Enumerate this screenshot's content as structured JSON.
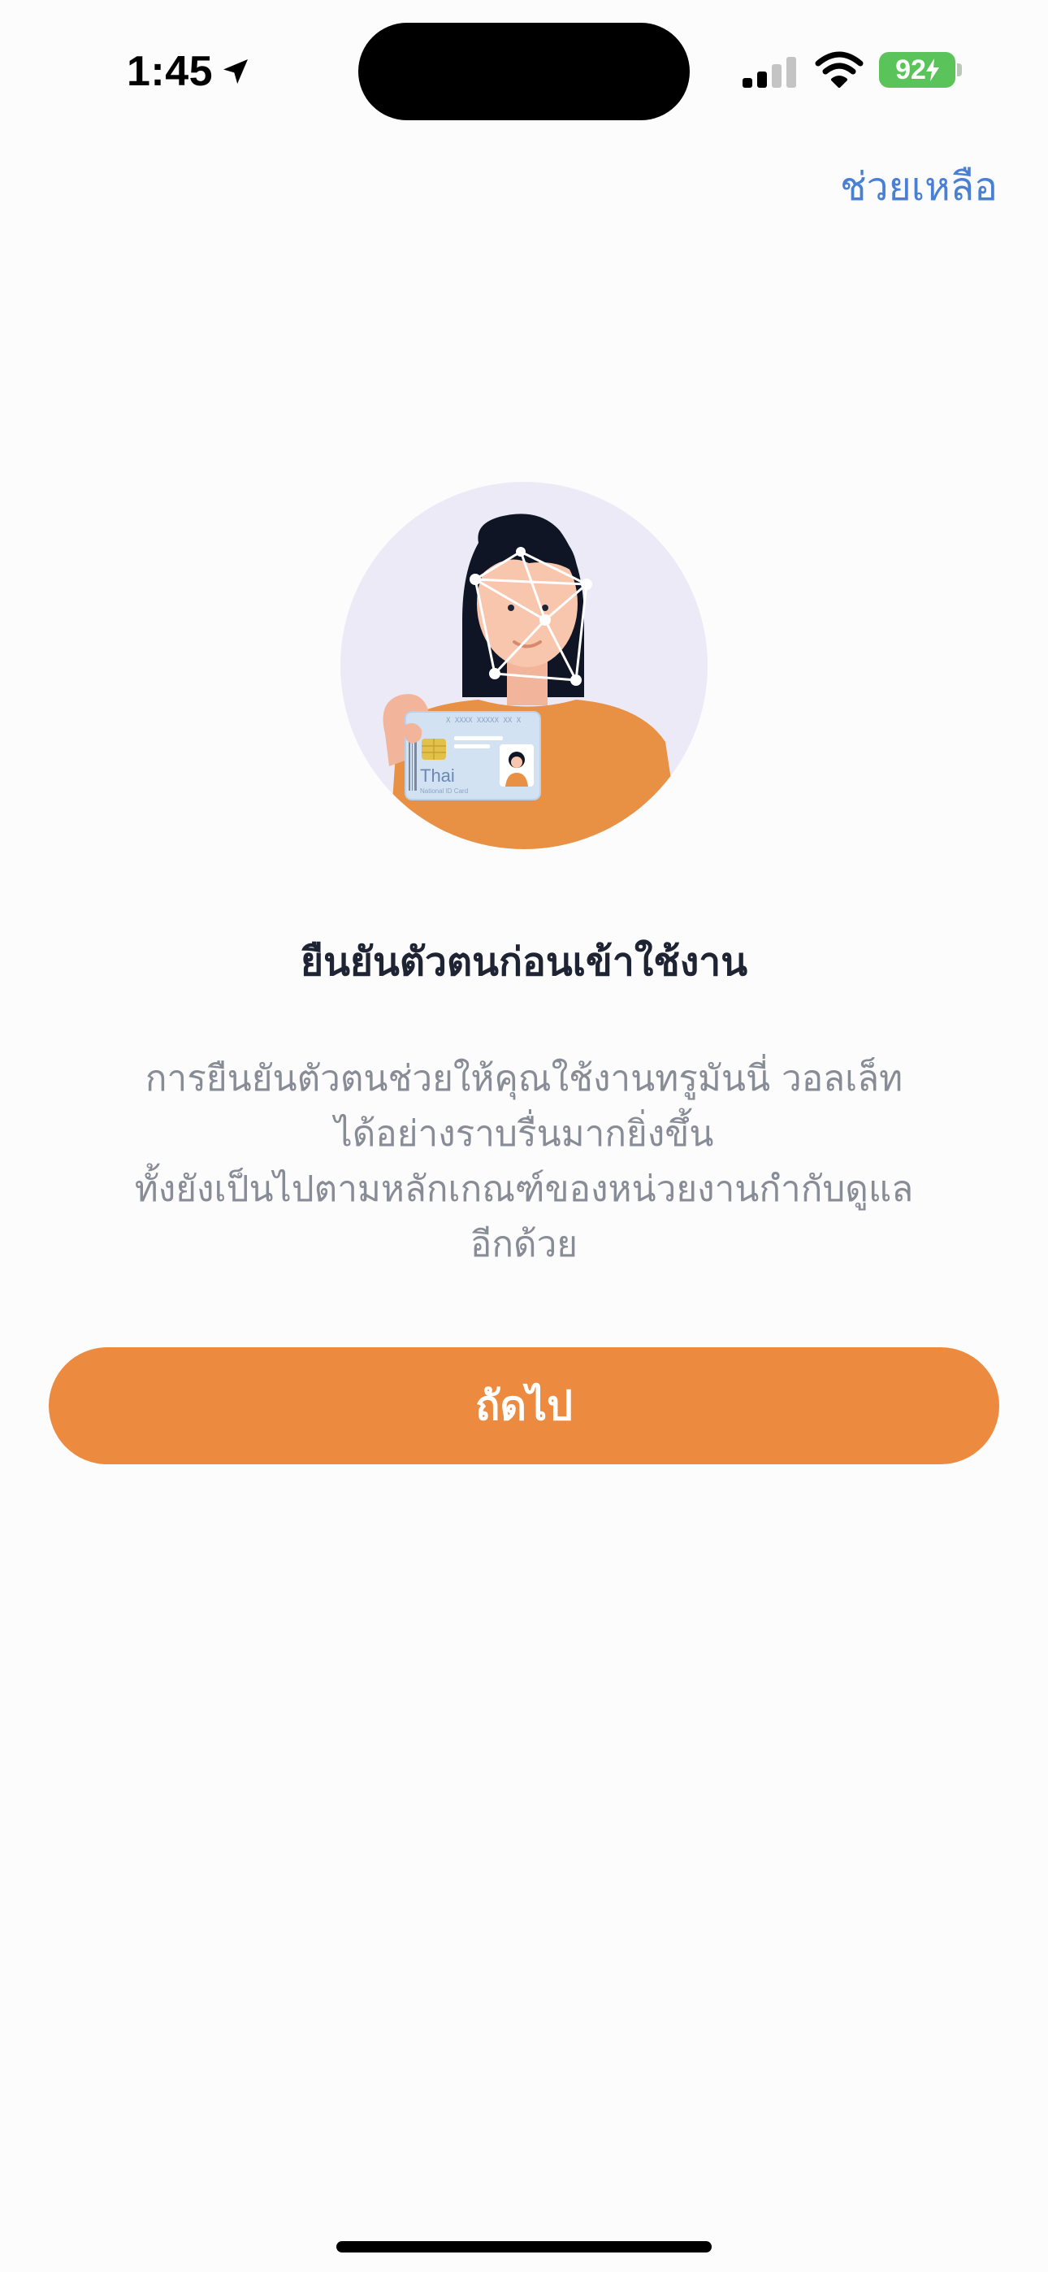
{
  "status_bar": {
    "time": "1:45",
    "battery": "92",
    "icons": [
      "location-arrow-icon",
      "cellular-signal-icon",
      "wifi-icon",
      "battery-charging-icon"
    ]
  },
  "header": {
    "help_label": "ช่วยเหลือ"
  },
  "illustration": {
    "card_text": "Thai",
    "card_subtext": "National ID Card",
    "card_number": "X XXXX XXXXX XX X"
  },
  "content": {
    "title": "ยืนยันตัวตนก่อนเข้าใช้งาน",
    "description_lines": [
      "การยืนยันตัวตนช่วยให้คุณใช้งานทรูมันนี่ วอลเล็ท",
      "ได้อย่างราบรื่นมากยิ่งขึ้น",
      "ทั้งยังเป็นไปตามหลักเกณฑ์ของหน่วยงานกำกับดูแล",
      "อีกด้วย"
    ]
  },
  "actions": {
    "next_label": "ถัดไป"
  },
  "colors": {
    "accent": "#ec8b3f",
    "link": "#4a7fd6",
    "title": "#1e2433",
    "body_text": "#888c96",
    "battery": "#5ac45b"
  }
}
